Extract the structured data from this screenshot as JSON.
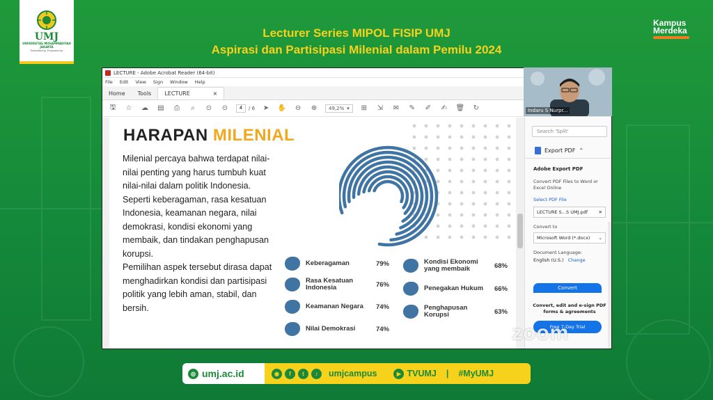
{
  "header": {
    "logo_text": "UMJ",
    "logo_sub": "UNIVERSITAS MUHAMMADIYAH JAKARTA",
    "logo_tagline": "Enlightening, Empowering",
    "title_line1": "Lecturer Series MIPOL FISIP UMJ",
    "title_line2": "Aspirasi dan Partisipasi Milenial dalam Pemilu 2024",
    "partner_logo_line1": "Kampus",
    "partner_logo_line2": "Merdeka"
  },
  "acrobat": {
    "window_title": "LECTURE - Adobe Acrobat Reader (64-bit)",
    "menu": [
      "File",
      "Edit",
      "View",
      "Sign",
      "Window",
      "Help"
    ],
    "tabs": {
      "home": "Home",
      "tools": "Tools",
      "document": "LECTURE",
      "close": "×"
    },
    "page_current": "4",
    "page_total": "/ 6",
    "zoom": "49,2%"
  },
  "slide": {
    "title_dark": "HARAPAN",
    "title_accent": "MILENIAL",
    "paragraph1": "Milenial percaya bahwa terdapat nilai-nilai penting yang harus tumbuh kuat nilai-nilai dalam politik Indonesia.",
    "paragraph2": "Seperti keberagaman, rasa kesatuan Indonesia, keamanan negara, nilai demokrasi, kondisi ekonomi yang membaik, dan tindakan penghapusan korupsi.",
    "paragraph3": "Pemilihan aspek tersebut dirasa dapat menghadirkan kondisi dan partisipasi politik yang lebih aman, stabil, dan bersih.",
    "legend": [
      {
        "label": "Keberagaman",
        "value": "79%"
      },
      {
        "label": "Rasa Kesatuan Indonesia",
        "value": "76%"
      },
      {
        "label": "Keamanan Negara",
        "value": "74%"
      },
      {
        "label": "Nilai Demokrasi",
        "value": "74%"
      },
      {
        "label": "Kondisi Ekonomi yang membaik",
        "value": "68%"
      },
      {
        "label": "Penegakan Hukum",
        "value": "66%"
      },
      {
        "label": "Penghapusan Korupsi",
        "value": "63%"
      }
    ],
    "ring_color": "#3f74a3"
  },
  "sidebar": {
    "search_placeholder": "Search 'Split'",
    "export_label": "Export PDF",
    "heading": "Adobe Export PDF",
    "description": "Convert PDF Files to Word or Excel Online",
    "select_label": "Select PDF File",
    "file_name": "LECTURE S...S UMJ.pdf",
    "convert_to_label": "Convert to",
    "convert_to_value": "Microsoft Word (*.docx)",
    "doc_lang_label": "Document Language:",
    "doc_lang_value": "English (U.S.)",
    "change_link": "Change",
    "convert_button": "Convert",
    "footer_text": "Convert, edit and e-sign PDF forms & agreements",
    "trial_button": "Free 7-Day Trial"
  },
  "zoom_watermark": "zoom",
  "webcam": {
    "participant_name": "Indaru S Nurpr..."
  },
  "footer": {
    "site": "umj.ac.id",
    "social_handle": "umjcampus",
    "youtube": "TVUMJ",
    "separator": "|",
    "hashtag": "#MyUMJ"
  },
  "colors": {
    "brand_green": "#1a8a3a",
    "brand_yellow": "#f7d21c",
    "accent_orange": "#f2a81d",
    "acrobat_blue": "#1473e6"
  }
}
